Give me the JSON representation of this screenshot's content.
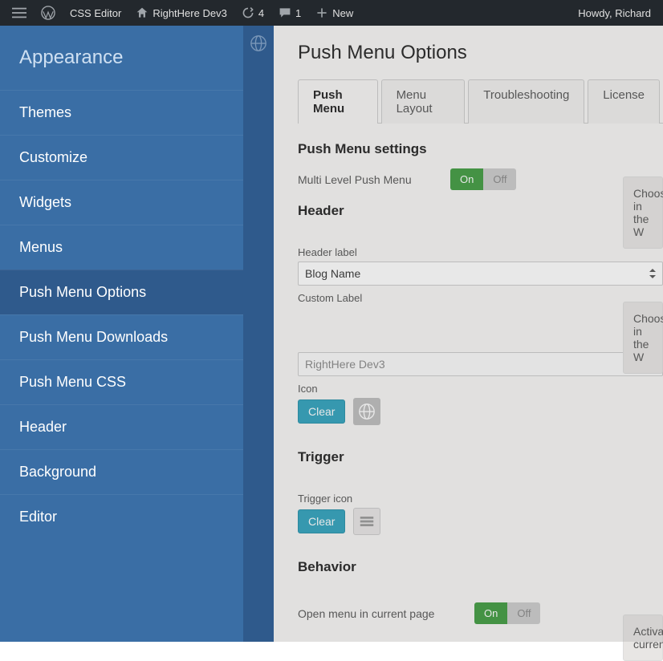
{
  "adminbar": {
    "css_editor": "CSS Editor",
    "site_name": "RightHere Dev3",
    "updates_count": "4",
    "comments_count": "1",
    "new_label": "New",
    "howdy": "Howdy, Richard"
  },
  "sidebar": {
    "heading": "Appearance",
    "items": [
      {
        "label": "Themes"
      },
      {
        "label": "Customize"
      },
      {
        "label": "Widgets"
      },
      {
        "label": "Menus"
      },
      {
        "label": "Push Menu Options"
      },
      {
        "label": "Push Menu Downloads"
      },
      {
        "label": "Push Menu CSS"
      },
      {
        "label": "Header"
      },
      {
        "label": "Background"
      },
      {
        "label": "Editor"
      }
    ]
  },
  "main": {
    "title": "Push Menu Options",
    "tabs": [
      "Push Menu",
      "Menu Layout",
      "Troubleshooting",
      "License"
    ],
    "sections": {
      "settings_title": "Push Menu settings",
      "multi_level_label": "Multi Level Push Menu",
      "header_title": "Header",
      "header_label_field": "Header label",
      "header_label_value": "Blog Name",
      "custom_label_field": "Custom Label",
      "custom_label_value": "RightHere Dev3",
      "icon_label": "Icon",
      "trigger_title": "Trigger",
      "trigger_icon_label": "Trigger icon",
      "behavior_title": "Behavior",
      "open_in_current_label": "Open menu in current page"
    },
    "toggle": {
      "on": "On",
      "off": "Off"
    },
    "clear_btn": "Clear",
    "info1": "Choose",
    "info1b": "in the W",
    "info2": "Choose",
    "info2b": "in the W",
    "info3": "Activat",
    "info3b": "current"
  }
}
